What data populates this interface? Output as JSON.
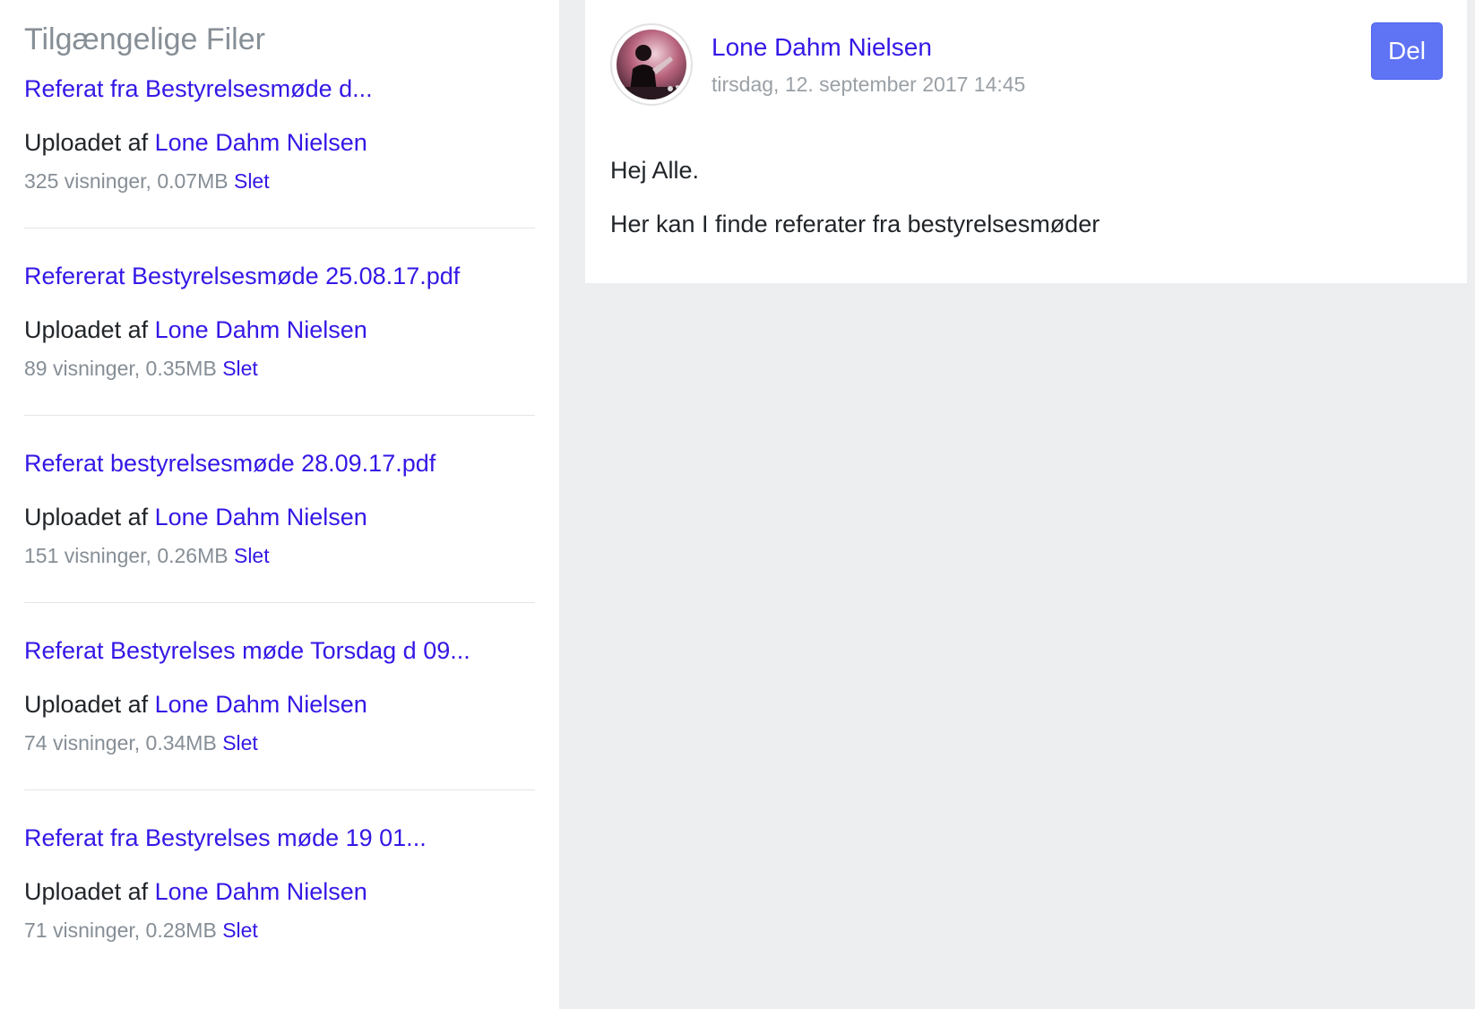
{
  "sidebar": {
    "title": "Tilgængelige Filer",
    "files": [
      {
        "name": "Referat fra Bestyrelsesmøde d...",
        "uploaded_prefix": "Uploadet af",
        "uploader": "Lone Dahm Nielsen",
        "stats": "325 visninger, 0.07MB",
        "delete_label": "Slet"
      },
      {
        "name": "Refererat Bestyrelsesmøde 25.08.17.pdf",
        "uploaded_prefix": "Uploadet af",
        "uploader": "Lone Dahm Nielsen",
        "stats": "89 visninger, 0.35MB",
        "delete_label": "Slet"
      },
      {
        "name": "Referat bestyrelsesmøde 28.09.17.pdf",
        "uploaded_prefix": "Uploadet af",
        "uploader": "Lone Dahm Nielsen",
        "stats": "151 visninger, 0.26MB",
        "delete_label": "Slet"
      },
      {
        "name": "Referat Bestyrelses møde Torsdag d 09...",
        "uploaded_prefix": "Uploadet af",
        "uploader": "Lone Dahm Nielsen",
        "stats": "74 visninger, 0.34MB",
        "delete_label": "Slet"
      },
      {
        "name": "Referat fra Bestyrelses møde 19 01...",
        "uploaded_prefix": "Uploadet af",
        "uploader": "Lone Dahm Nielsen",
        "stats": "71 visninger, 0.28MB",
        "delete_label": "Slet"
      }
    ]
  },
  "post": {
    "author": "Lone Dahm Nielsen",
    "date": "tirsdag, 12. september 2017 14:45",
    "share_label": "Del",
    "body": [
      "Hej Alle.",
      "Her kan I finde referater fra bestyrelsesmøder"
    ]
  },
  "colors": {
    "link": "#3318e6",
    "muted": "#868e96",
    "text": "#212529",
    "button": "#5f73f5",
    "background": "#eceeef"
  }
}
